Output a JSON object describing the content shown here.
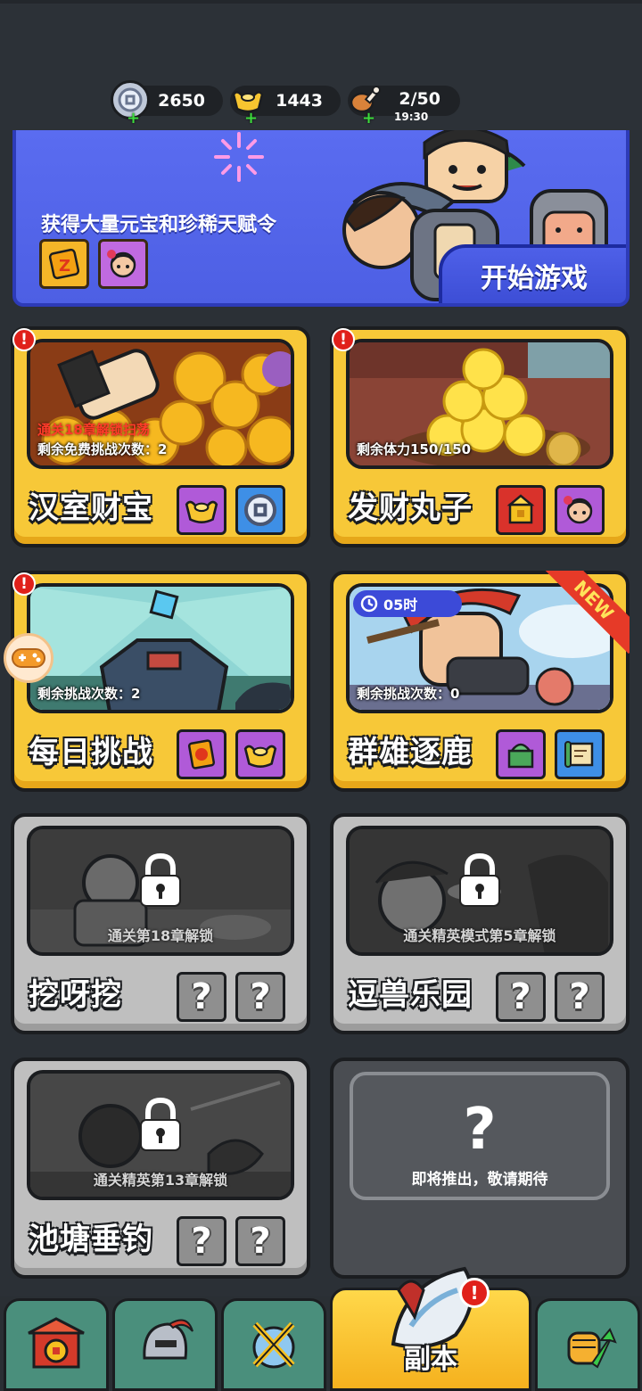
{
  "resources": {
    "coins": "2650",
    "ingots": "1443",
    "stamina": "2/50",
    "stamina_timer": "19:30",
    "plus": "+"
  },
  "banner": {
    "description": "获得大量元宝和珍稀天赋令",
    "start_label": "开始游戏"
  },
  "cards": {
    "c1": {
      "name": "汉室财宝",
      "locked_note": "通关18章解锁扫荡",
      "info": "剩余免费挑战次数：2",
      "alert": "!"
    },
    "c2": {
      "name": "发财丸子",
      "info": "剩余体力150/150",
      "alert": "!"
    },
    "c3": {
      "name": "每日挑战",
      "info": "剩余挑战次数：2",
      "alert": "!"
    },
    "c4": {
      "name": "群雄逐鹿",
      "info": "剩余挑战次数：0",
      "timer": "05时",
      "new_tag": "NEW"
    },
    "c5": {
      "name": "挖呀挖",
      "lock_msg": "通关第18章解锁"
    },
    "c6": {
      "name": "逗兽乐园",
      "lock_msg": "通关精英模式第5章解锁"
    },
    "c7": {
      "name": "池塘垂钓",
      "lock_msg": "通关精英第13章解锁"
    },
    "c8": {
      "coming": "即将推出，敬请期待",
      "q": "?"
    }
  },
  "unknown_reward": "?",
  "nav": {
    "active_label": "副本",
    "badge": "!"
  },
  "colors": {
    "card_gold": "#f7c838",
    "card_gray": "#bfbfbf",
    "banner_blue": "#5a6cf0",
    "nav_green": "#4a8f7c",
    "alert_red": "#e0201a"
  }
}
